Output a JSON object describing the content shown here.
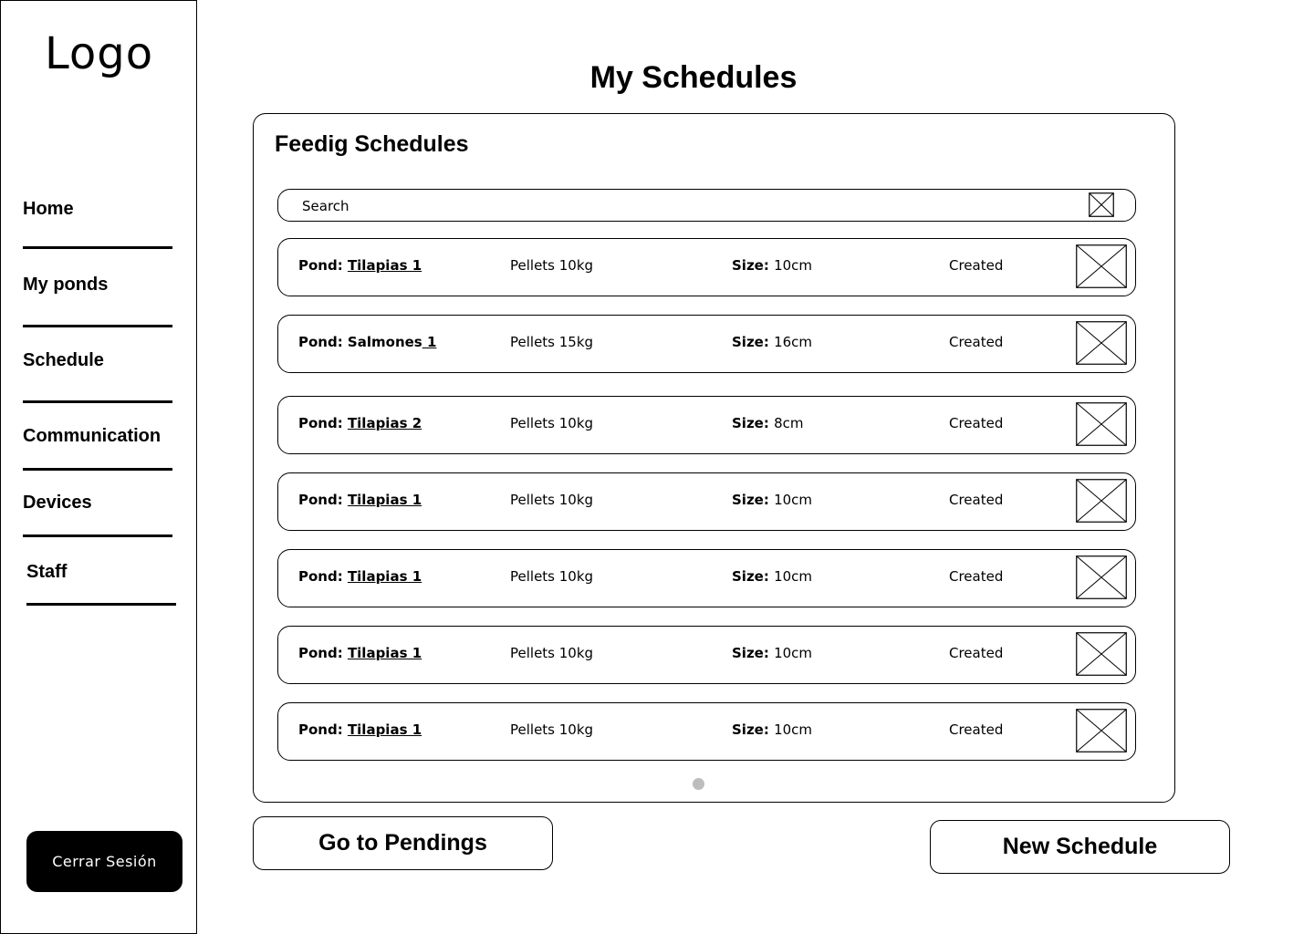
{
  "sidebar": {
    "logo": "Logo",
    "items": [
      {
        "label": "Home"
      },
      {
        "label": "My ponds"
      },
      {
        "label": "Schedule"
      },
      {
        "label": "Communication"
      },
      {
        "label": "Devices"
      },
      {
        "label": "Staff"
      }
    ],
    "logout_label": "Cerrar Sesión"
  },
  "main": {
    "title": "My Schedules",
    "panel_title": "Feedig Schedules",
    "search": {
      "placeholder": "Search",
      "icon": "image-placeholder-icon"
    },
    "rows": [
      {
        "pond_label": "Pond: ",
        "pond_name": "Tilapias 1",
        "food": "Pellets 10kg",
        "size_label": "Size: ",
        "size_value": "10cm",
        "status": "Created"
      },
      {
        "pond_label": "Pond: Salmones",
        "pond_name": " 1",
        "food": "Pellets 15kg",
        "size_label": "Size: ",
        "size_value": "16cm",
        "status": "Created"
      },
      {
        "pond_label": "Pond: ",
        "pond_name": "Tilapias 2",
        "food": "Pellets 10kg",
        "size_label": "Size: ",
        "size_value": "8cm",
        "status": "Created"
      },
      {
        "pond_label": "Pond: ",
        "pond_name": "Tilapias 1",
        "food": "Pellets 10kg",
        "size_label": "Size: ",
        "size_value": "10cm",
        "status": "Created"
      },
      {
        "pond_label": "Pond: ",
        "pond_name": "Tilapias 1",
        "food": "Pellets 10kg",
        "size_label": "Size: ",
        "size_value": "10cm",
        "status": "Created"
      },
      {
        "pond_label": "Pond: ",
        "pond_name": "Tilapias 1",
        "food": "Pellets 10kg",
        "size_label": "Size: ",
        "size_value": "10cm",
        "status": "Created"
      },
      {
        "pond_label": "Pond: ",
        "pond_name": "Tilapias 1",
        "food": "Pellets 10kg",
        "size_label": "Size: ",
        "size_value": "10cm",
        "status": "Created"
      }
    ],
    "buttons": {
      "pendings": "Go to Pendings",
      "new_schedule": "New Schedule"
    }
  }
}
